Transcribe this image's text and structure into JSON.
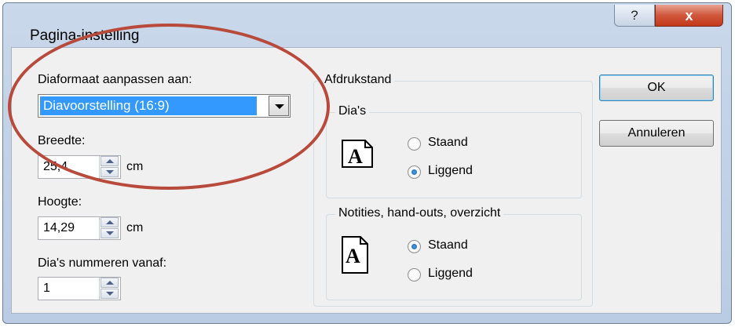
{
  "window": {
    "title": "Pagina-instelling",
    "help_label": "?",
    "close_label": "x"
  },
  "left": {
    "size_label": "Diaformaat aanpassen aan:",
    "size_value": "Diavoorstelling (16:9)",
    "width_label": "Breedte:",
    "width_value": "25,4",
    "width_unit": "cm",
    "height_label": "Hoogte:",
    "height_value": "14,29",
    "height_unit": "cm",
    "number_label": "Dia's nummeren vanaf:",
    "number_value": "1"
  },
  "orientation": {
    "group_label": "Afdrukstand",
    "slides": {
      "label": "Dia's",
      "portrait": "Staand",
      "landscape": "Liggend",
      "selected": "Liggend"
    },
    "notes": {
      "label": "Notities, hand-outs, overzicht",
      "portrait": "Staand",
      "landscape": "Liggend",
      "selected": "Staand"
    },
    "icon_letter": "A"
  },
  "buttons": {
    "ok": "OK",
    "cancel": "Annuleren"
  },
  "colors": {
    "highlight": "#3399ff",
    "annotation_oval": "#b84a3c"
  }
}
